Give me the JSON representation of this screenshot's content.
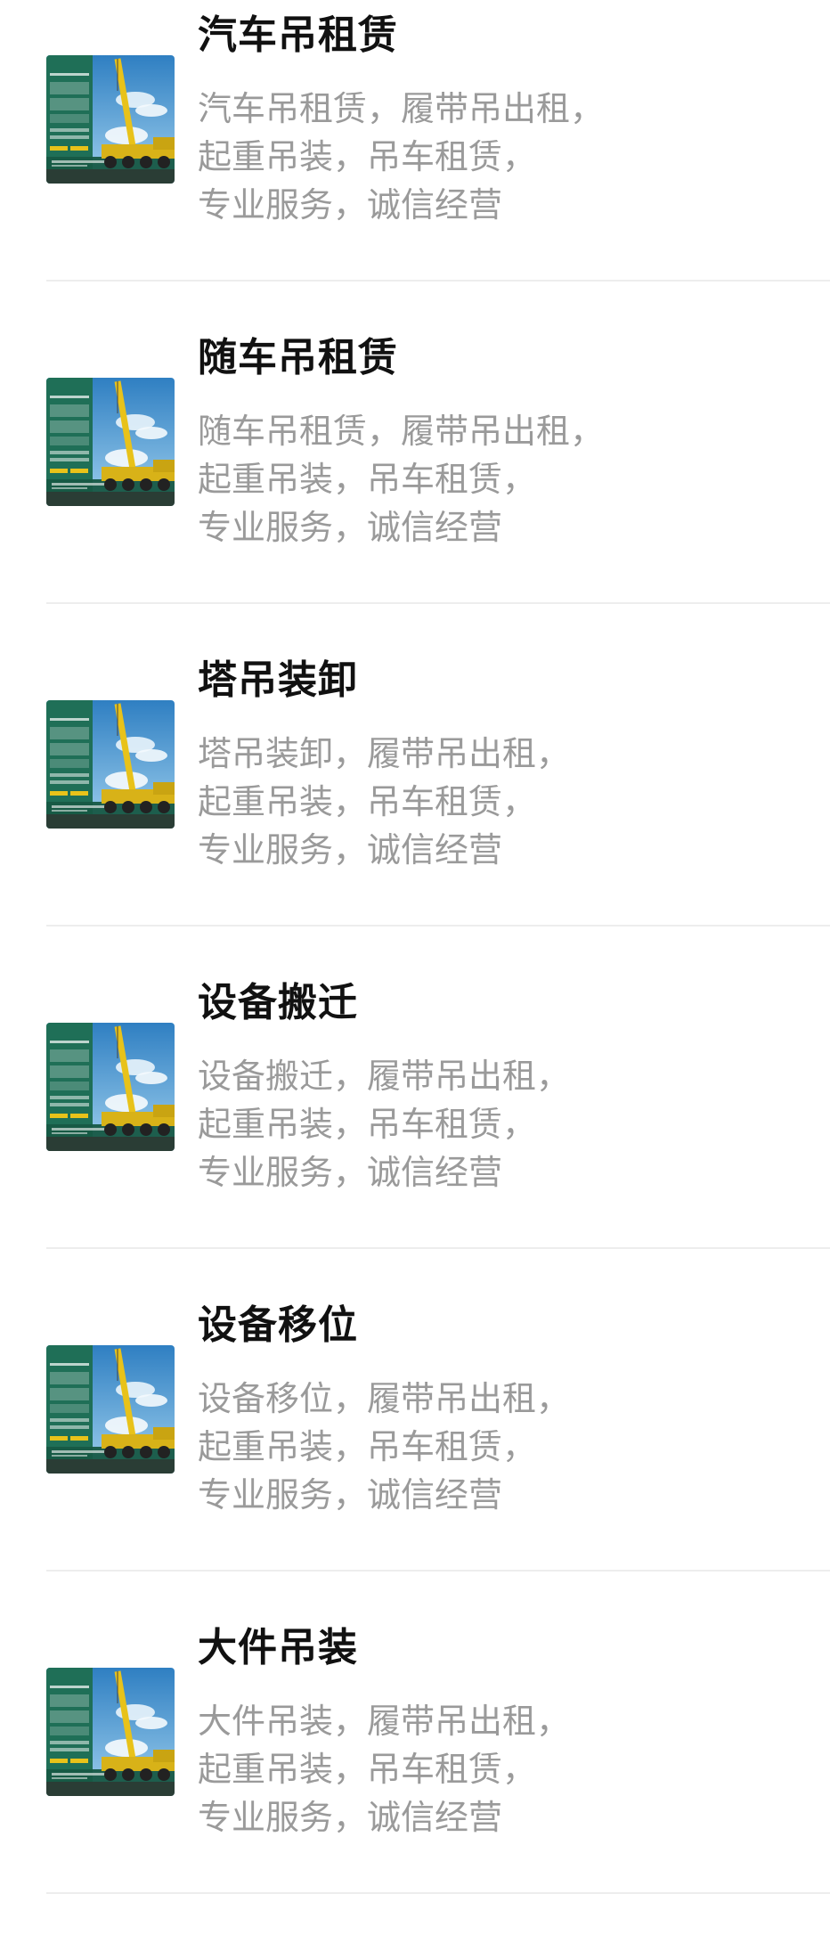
{
  "items": [
    {
      "title": "汽车吊租赁",
      "desc_lines": [
        "汽车吊租赁，履带吊出租，",
        "起重吊装，吊车租赁，",
        "专业服务，诚信经营"
      ]
    },
    {
      "title": "随车吊租赁",
      "desc_lines": [
        "随车吊租赁，履带吊出租，",
        "起重吊装，吊车租赁，",
        "专业服务，诚信经营"
      ]
    },
    {
      "title": "塔吊装卸",
      "desc_lines": [
        "塔吊装卸，履带吊出租，",
        "起重吊装，吊车租赁，",
        "专业服务，诚信经营"
      ]
    },
    {
      "title": "设备搬迁",
      "desc_lines": [
        "设备搬迁，履带吊出租，",
        "起重吊装，吊车租赁，",
        "专业服务，诚信经营"
      ]
    },
    {
      "title": "设备移位",
      "desc_lines": [
        "设备移位，履带吊出租，",
        "起重吊装，吊车租赁，",
        "专业服务，诚信经营"
      ]
    },
    {
      "title": "大件吊装",
      "desc_lines": [
        "大件吊装，履带吊出租，",
        "起重吊装，吊车租赁，",
        "专业服务，诚信经营"
      ]
    }
  ],
  "thumbnail": {
    "icon": "crane-truck-poster-icon",
    "colors": {
      "sky": "#2f86c8",
      "panel": "#1f6f57",
      "crane": "#e8c21a",
      "truck": "#d8b218"
    },
    "poster_text": [
      "南京宁朋",
      "起重吊装",
      "技术有限公司"
    ]
  }
}
